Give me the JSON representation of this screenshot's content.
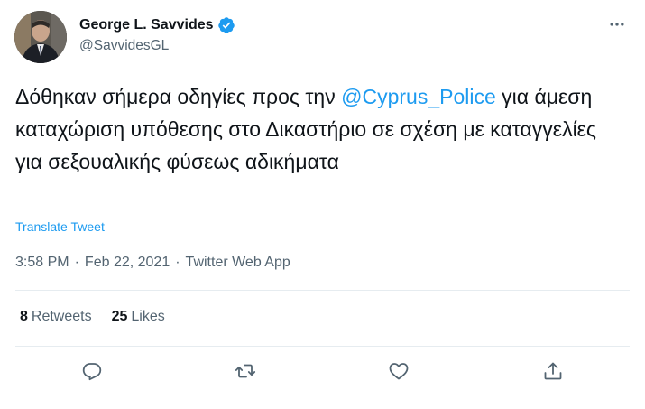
{
  "author": {
    "display_name": "George L. Savvides",
    "handle": "@SavvidesGL",
    "verified": true
  },
  "tweet": {
    "text_before": "Δόθηκαν σήμερα οδηγίες προς την ",
    "mention": "@Cyprus_Police",
    "text_after": " για άμεση καταχώριση υπόθεσης στο Δικαστήριο σε σχέση με καταγγελίες για σεξουαλικής φύσεως αδικήματα",
    "translate_label": "Translate Tweet"
  },
  "meta": {
    "time": "3:58 PM",
    "separator": "·",
    "date": "Feb 22, 2021",
    "source": "Twitter Web App"
  },
  "stats": {
    "retweets_count": "8",
    "retweets_label": "Retweets",
    "likes_count": "25",
    "likes_label": "Likes"
  },
  "colors": {
    "accent": "#1d9bf0",
    "secondary_text": "#536471",
    "primary_text": "#0f1419",
    "divider": "#e6ecf0"
  },
  "icons": {
    "more": "more-horizontal-icon",
    "reply": "reply-icon",
    "retweet": "retweet-icon",
    "like": "heart-icon",
    "share": "share-icon",
    "verified": "verified-badge-icon"
  }
}
